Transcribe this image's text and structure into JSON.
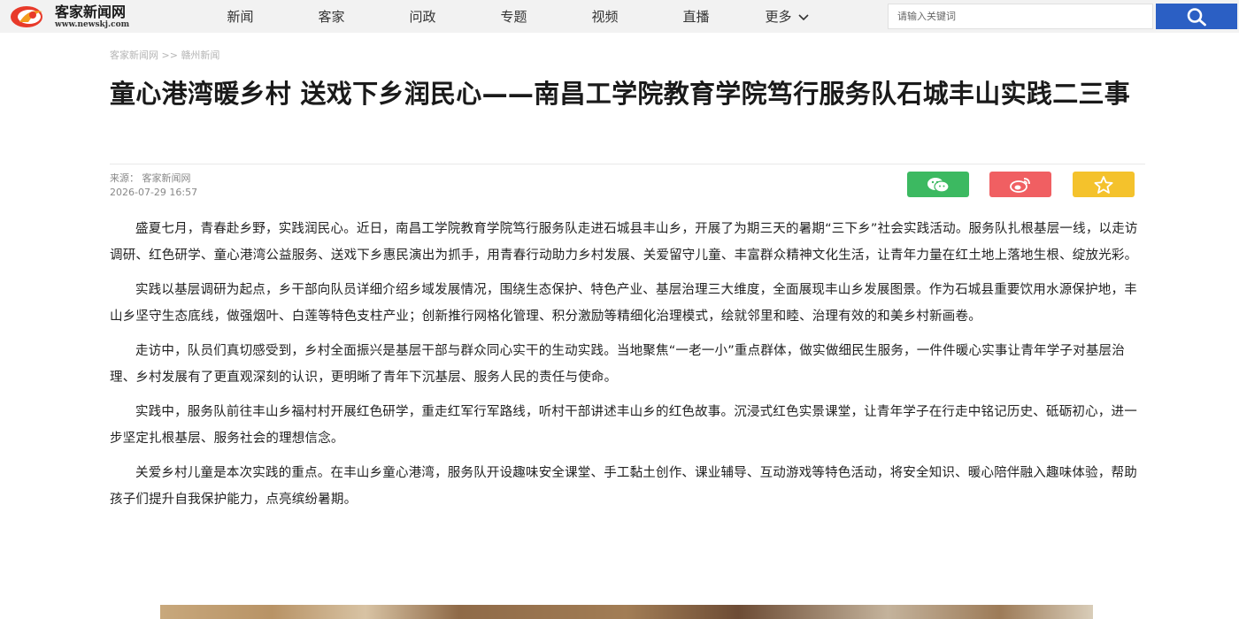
{
  "site": {
    "logo_name": "客家新闻网",
    "logo_url": "www.newskj.com",
    "brand_colors": {
      "red": "#e83a2a",
      "orange": "#f39b1e",
      "search_blue": "#2b5fc4"
    }
  },
  "nav": {
    "items": [
      "新闻",
      "客家",
      "问政",
      "专题",
      "视频",
      "直播"
    ],
    "more_label": "更多"
  },
  "search": {
    "placeholder": "请输入关键词",
    "icon": "search-icon"
  },
  "breadcrumb": {
    "home": "客家新闻网",
    "separator": ">>",
    "section": "赣州新闻"
  },
  "article": {
    "title": "童心港湾暖乡村 送戏下乡润民心——南昌工学院教育学院笃行服务队石城丰山实践二三事",
    "source_label": "来源：",
    "source": "客家新闻网",
    "datetime": "2026-07-29 16:57",
    "paragraphs": [
      "盛夏七月，青春赴乡野，实践润民心。近日，南昌工学院教育学院笃行服务队走进石城县丰山乡，开展了为期三天的暑期“三下乡”社会实践活动。服务队扎根基层一线，以走访调研、红色研学、童心港湾公益服务、送戏下乡惠民演出为抓手，用青春行动助力乡村发展、关爱留守儿童、丰富群众精神文化生活，让青年力量在红土地上落地生根、绽放光彩。",
      "实践以基层调研为起点，乡干部向队员详细介绍乡域发展情况，围绕生态保护、特色产业、基层治理三大维度，全面展现丰山乡发展图景。作为石城县重要饮用水源保护地，丰山乡坚守生态底线，做强烟叶、白莲等特色支柱产业；创新推行网格化管理、积分激励等精细化治理模式，绘就邻里和睦、治理有效的和美乡村新画卷。",
      "走访中，队员们真切感受到，乡村全面振兴是基层干部与群众同心实干的生动实践。当地聚焦“一老一小”重点群体，做实做细民生服务，一件件暖心实事让青年学子对基层治理、乡村发展有了更直观深刻的认识，更明晰了青年下沉基层、服务人民的责任与使命。",
      "实践中，服务队前往丰山乡福村村开展红色研学，重走红军行军路线，听村干部讲述丰山乡的红色故事。沉浸式红色实景课堂，让青年学子在行走中铭记历史、砥砺初心，进一步坚定扎根基层、服务社会的理想信念。",
      "关爱乡村儿童是本次实践的重点。在丰山乡童心港湾，服务队开设趣味安全课堂、手工黏土创作、课业辅导、互动游戏等特色活动，将安全知识、暖心陪伴融入趣味体验，帮助孩子们提升自我保护能力，点亮缤纷暑期。"
    ]
  },
  "share": {
    "wechat": {
      "icon": "wechat-icon",
      "color": "#3cb961"
    },
    "weibo": {
      "icon": "weibo-icon",
      "color": "#f05f62"
    },
    "favorite": {
      "icon": "star-icon",
      "color": "#f4c22c"
    }
  }
}
